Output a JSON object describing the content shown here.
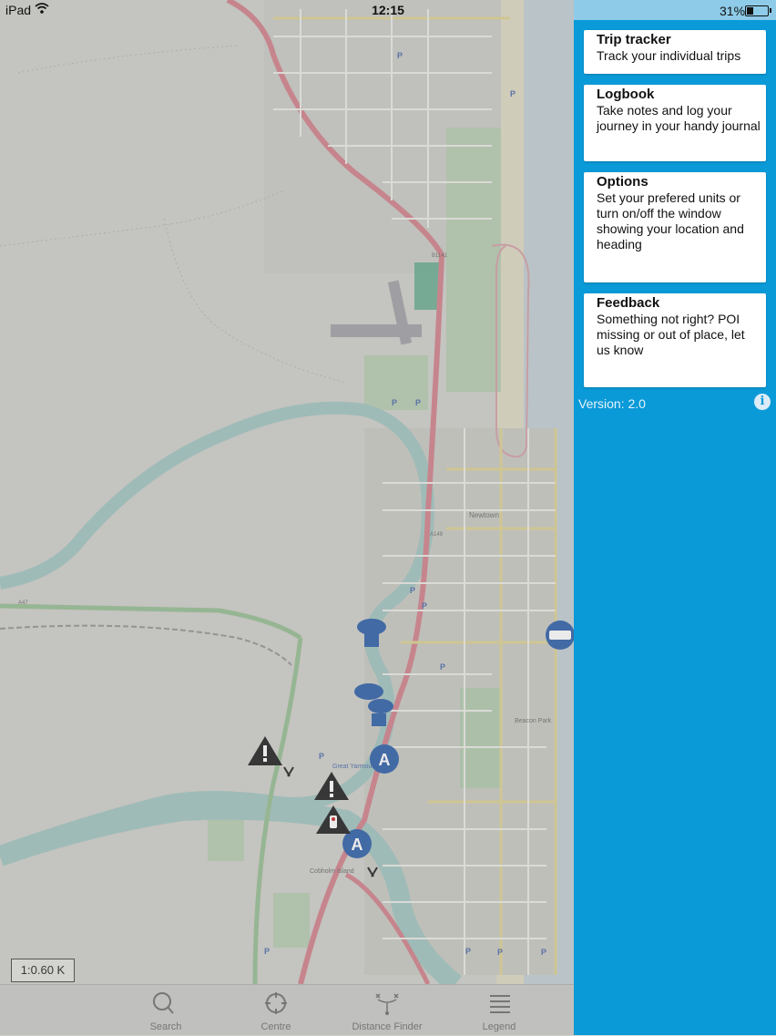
{
  "status_bar": {
    "carrier": "iPad",
    "time": "12:15",
    "battery_percent": "31%",
    "battery_level": 0.31
  },
  "map": {
    "scale_label": "1:0.60 K",
    "labels": {
      "newtown": "Newtown",
      "great_yarmouth": "Great Yarmouth",
      "cobholm": "Cobholm Island",
      "beacon_park": "Beacon Park",
      "a149": "A149",
      "a47": "A47",
      "b1141": "B1141"
    }
  },
  "tab_bar": {
    "items": [
      {
        "label": "Search",
        "icon": "search-icon"
      },
      {
        "label": "Centre",
        "icon": "crosshair-icon"
      },
      {
        "label": "Distance Finder",
        "icon": "distance-icon"
      },
      {
        "label": "Legend",
        "icon": "list-icon"
      }
    ]
  },
  "panel": {
    "cards": [
      {
        "title": "Trip tracker",
        "description": "Track your individual trips"
      },
      {
        "title": "Logbook",
        "description": "Take notes and log your journey in your handy journal"
      },
      {
        "title": "Options",
        "description": "Set your prefered units or turn on/off the window showing your location and heading"
      },
      {
        "title": "Feedback",
        "description": "Something not right? POI missing or out of place, let us know"
      }
    ],
    "version": "Version: 2.0"
  },
  "colors": {
    "panel_blue": "#0a9ad8",
    "marker_blue": "#3f6db0",
    "road_red": "#d58b95",
    "river": "#a9c9c4"
  }
}
